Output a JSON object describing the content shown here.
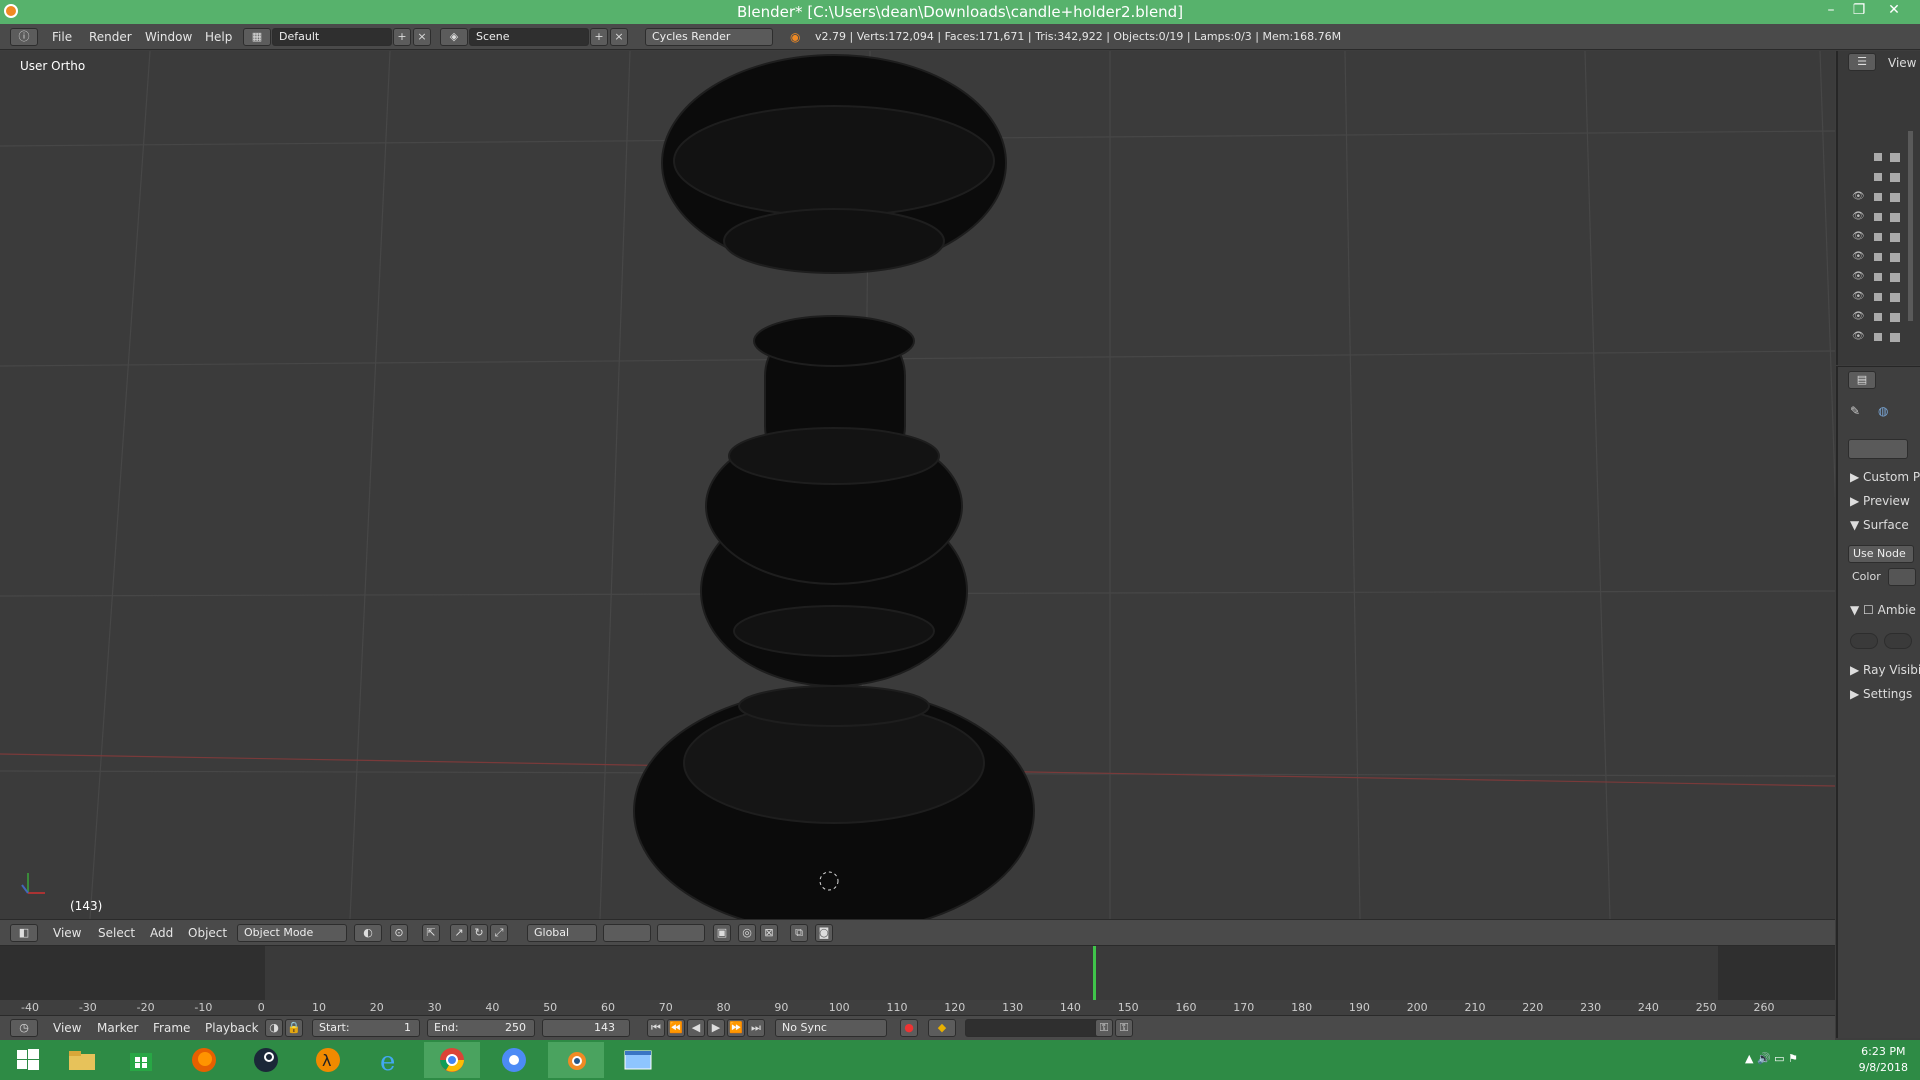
{
  "window": {
    "title": "Blender* [C:\\Users\\dean\\Downloads\\candle+holder2.blend]",
    "minimize_label": "–",
    "restore_label": "❐",
    "close_label": "✕"
  },
  "info_header": {
    "menus": [
      "File",
      "Render",
      "Window",
      "Help"
    ],
    "layout": "Default",
    "scene": "Scene",
    "engine": "Cycles Render",
    "stats": "v2.79 | Verts:172,094 | Faces:171,671 | Tris:342,922 | Objects:0/19 | Lamps:0/3 | Mem:168.76M"
  },
  "viewport": {
    "view_name": "User Ortho",
    "frame": "(143)"
  },
  "viewport_header": {
    "menus": [
      "View",
      "Select",
      "Add",
      "Object"
    ],
    "mode": "Object Mode",
    "orientation": "Global"
  },
  "outliner": {
    "view_label": "View"
  },
  "properties": {
    "panels": [
      "Custom Pr",
      "Preview",
      "Surface",
      "Ambie",
      "Ray Visibi",
      "Settings"
    ],
    "use_nodes_label": "Use Node",
    "color_label": "Color"
  },
  "timeline": {
    "ticks": [
      "-40",
      "-30",
      "-20",
      "-10",
      "0",
      "10",
      "20",
      "30",
      "40",
      "50",
      "60",
      "70",
      "80",
      "90",
      "100",
      "110",
      "120",
      "130",
      "140",
      "150",
      "160",
      "170",
      "180",
      "190",
      "200",
      "210",
      "220",
      "230",
      "240",
      "250",
      "260"
    ],
    "current_frame": 143,
    "menus": [
      "View",
      "Marker",
      "Frame",
      "Playback"
    ],
    "start_label": "Start:",
    "start_value": "1",
    "end_label": "End:",
    "end_value": "250",
    "frame_value": "143",
    "sync": "No Sync"
  },
  "taskbar": {
    "apps": [
      "start-icon",
      "file-explorer-icon",
      "store-icon",
      "firefox-icon",
      "steam-icon",
      "half-life-icon",
      "internet-explorer-icon",
      "chrome-icon",
      "chrome-alt-icon",
      "blender-icon",
      "window-app-icon"
    ],
    "time": "6:23 PM",
    "date": "9/8/2018"
  }
}
